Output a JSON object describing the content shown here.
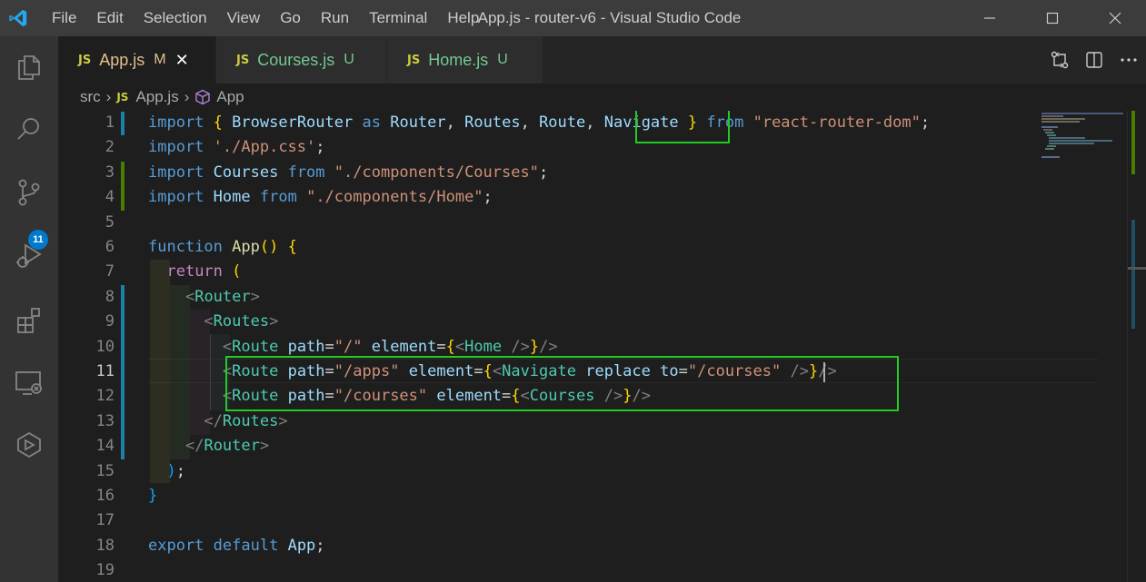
{
  "titlebar": {
    "menu": [
      "File",
      "Edit",
      "Selection",
      "View",
      "Go",
      "Run",
      "Terminal",
      "Help"
    ],
    "title": "App.js - router-v6 - Visual Studio Code"
  },
  "activity_bar": {
    "items": [
      "explorer-icon",
      "search-icon",
      "source-control-icon",
      "run-debug-icon",
      "extensions-icon",
      "remote-explorer-icon",
      "live-share-icon"
    ],
    "source_control_badge": "11"
  },
  "tabs": [
    {
      "icon": "JS",
      "name": "App.js",
      "status": "M",
      "active": true,
      "close": "✕"
    },
    {
      "icon": "JS",
      "name": "Courses.js",
      "status": "U",
      "active": false
    },
    {
      "icon": "JS",
      "name": "Home.js",
      "status": "U",
      "active": false
    }
  ],
  "breadcrumb": {
    "folder": "src",
    "file_icon": "JS",
    "file": "App.js",
    "symbol": "App"
  },
  "editor": {
    "line_numbers": [
      "1",
      "2",
      "3",
      "4",
      "5",
      "6",
      "7",
      "8",
      "9",
      "10",
      "11",
      "12",
      "13",
      "14",
      "15",
      "16",
      "17",
      "18",
      "19"
    ],
    "current_line": "11",
    "lines": [
      "import { BrowserRouter as Router, Routes, Route, Navigate } from \"react-router-dom\";",
      "import './App.css';",
      "import Courses from \"./components/Courses\";",
      "import Home from \"./components/Home\";",
      "",
      "function App() {",
      "  return (",
      "    <Router>",
      "      <Routes>",
      "        <Route path=\"/\" element={<Home />}/>",
      "        <Route path=\"/apps\" element={<Navigate replace to=\"/courses\" />}/>",
      "        <Route path=\"/courses\" element={<Courses />}/>",
      "      </Routes>",
      "    </Router>",
      "  );",
      "}",
      "",
      "export default App;",
      ""
    ]
  },
  "colors": {
    "highlight_box": "#22cc22",
    "modified_tab": "#e2c08d",
    "untracked_tab": "#73c991",
    "badge": "#007acc"
  }
}
